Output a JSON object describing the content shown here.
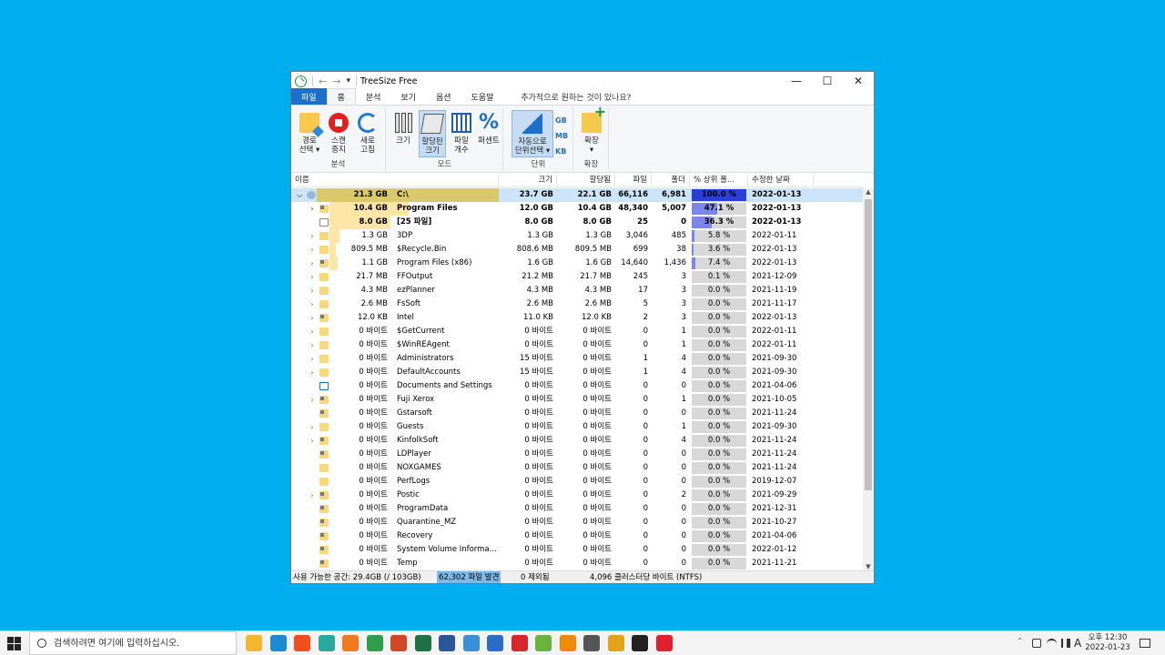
{
  "window": {
    "title": "TreeSize Free",
    "controls": {
      "minimize": "—",
      "maximize": "☐",
      "close": "✕"
    }
  },
  "quick_access": {
    "back": "←",
    "forward": "→",
    "more": "▾"
  },
  "tabs": [
    {
      "label": "파일",
      "state": "file"
    },
    {
      "label": "홈",
      "state": "active"
    },
    {
      "label": "분석",
      "state": ""
    },
    {
      "label": "보기",
      "state": ""
    },
    {
      "label": "옵션",
      "state": ""
    },
    {
      "label": "도움말",
      "state": ""
    },
    {
      "label": "추가적으로 원하는 것이 있나요?",
      "state": "tell"
    }
  ],
  "ribbon": {
    "groups": {
      "analysis": "분석",
      "mode": "모드",
      "unit": "단위",
      "expand": "확장"
    },
    "buttons": {
      "path_select": "경로\n선택 ▾",
      "stop_scan": "스캔\n중지",
      "refresh": "새로\n고침",
      "size": "크기",
      "allocated": "할당된\n크기",
      "file_count": "파일\n개수",
      "percent": "퍼센트",
      "auto_unit": "자동으로\n단위선택 ▾",
      "expand": "확장\n▾"
    },
    "unit_options": [
      "GB",
      "MB",
      "KB"
    ]
  },
  "columns": {
    "name": "이름",
    "size": "크기",
    "allocated": "할당됨",
    "files": "파일",
    "folders": "폴더",
    "pct": "% 상위 폴...",
    "modified": "수정한 날짜"
  },
  "rows": [
    {
      "exp": "⌵",
      "indent": 0,
      "icon": "drive",
      "sizeLabel": "21.3 GB",
      "name": "C:\\",
      "size": "23.7 GB",
      "alloc": "22.1 GB",
      "files": "66,116",
      "folders": "6,981",
      "pct": "100.0 %",
      "pctVal": 100,
      "barFrac": 1.0,
      "date": "2022-01-13",
      "bold": true,
      "selected": true
    },
    {
      "exp": "›",
      "indent": 1,
      "icon": "lock",
      "sizeLabel": "10.4 GB",
      "name": "Program Files",
      "size": "12.0 GB",
      "alloc": "10.4 GB",
      "files": "48,340",
      "folders": "5,007",
      "pct": "47.1 %",
      "pctVal": 47.1,
      "barFrac": 0.47,
      "date": "2022-01-13",
      "bold": true
    },
    {
      "exp": "",
      "indent": 1,
      "icon": "file",
      "sizeLabel": "8.0 GB",
      "name": "[25 파일]",
      "size": "8.0 GB",
      "alloc": "8.0 GB",
      "files": "25",
      "folders": "0",
      "pct": "36.3 %",
      "pctVal": 36.3,
      "barFrac": 0.36,
      "date": "2022-01-13",
      "bold": true
    },
    {
      "exp": "›",
      "indent": 1,
      "icon": "folder",
      "sizeLabel": "1.3 GB",
      "name": "3DP",
      "size": "1.3 GB",
      "alloc": "1.3 GB",
      "files": "3,046",
      "folders": "485",
      "pct": "5.8 %",
      "pctVal": 5.8,
      "barFrac": 0.06,
      "date": "2022-01-11"
    },
    {
      "exp": "›",
      "indent": 1,
      "icon": "folder",
      "sizeLabel": "809.5 MB",
      "name": "$Recycle.Bin",
      "size": "808.6 MB",
      "alloc": "809.5 MB",
      "files": "699",
      "folders": "38",
      "pct": "3.6 %",
      "pctVal": 3.6,
      "barFrac": 0.04,
      "date": "2022-01-13"
    },
    {
      "exp": "›",
      "indent": 1,
      "icon": "lock",
      "sizeLabel": "1.1 GB",
      "name": "Program Files (x86)",
      "size": "1.6 GB",
      "alloc": "1.6 GB",
      "files": "14,640",
      "folders": "1,436",
      "pct": "7.4 %",
      "pctVal": 7.4,
      "barFrac": 0.05,
      "date": "2022-01-13"
    },
    {
      "exp": "›",
      "indent": 1,
      "icon": "folder",
      "sizeLabel": "21.7 MB",
      "name": "FFOutput",
      "size": "21.2 MB",
      "alloc": "21.7 MB",
      "files": "245",
      "folders": "3",
      "pct": "0.1 %",
      "pctVal": 0.1,
      "barFrac": 0,
      "date": "2021-12-09"
    },
    {
      "exp": "›",
      "indent": 1,
      "icon": "folder",
      "sizeLabel": "4.3 MB",
      "name": "ezPlanner",
      "size": "4.3 MB",
      "alloc": "4.3 MB",
      "files": "17",
      "folders": "3",
      "pct": "0.0 %",
      "pctVal": 0,
      "barFrac": 0,
      "date": "2021-11-19"
    },
    {
      "exp": "›",
      "indent": 1,
      "icon": "folder",
      "sizeLabel": "2.6 MB",
      "name": "FsSoft",
      "size": "2.6 MB",
      "alloc": "2.6 MB",
      "files": "5",
      "folders": "3",
      "pct": "0.0 %",
      "pctVal": 0,
      "barFrac": 0,
      "date": "2021-11-17"
    },
    {
      "exp": "›",
      "indent": 1,
      "icon": "lock",
      "sizeLabel": "12.0 KB",
      "name": "Intel",
      "size": "11.0 KB",
      "alloc": "12.0 KB",
      "files": "2",
      "folders": "3",
      "pct": "0.0 %",
      "pctVal": 0,
      "barFrac": 0,
      "date": "2022-01-13"
    },
    {
      "exp": "›",
      "indent": 1,
      "icon": "folder",
      "sizeLabel": "0 바이트",
      "name": "$GetCurrent",
      "size": "0 바이트",
      "alloc": "0 바이트",
      "files": "0",
      "folders": "1",
      "pct": "0.0 %",
      "pctVal": 0,
      "barFrac": 0,
      "date": "2022-01-11"
    },
    {
      "exp": "›",
      "indent": 1,
      "icon": "folder",
      "sizeLabel": "0 바이트",
      "name": "$WinREAgent",
      "size": "0 바이트",
      "alloc": "0 바이트",
      "files": "0",
      "folders": "1",
      "pct": "0.0 %",
      "pctVal": 0,
      "barFrac": 0,
      "date": "2022-01-11"
    },
    {
      "exp": "›",
      "indent": 1,
      "icon": "folder",
      "sizeLabel": "0 바이트",
      "name": "Administrators",
      "size": "15 바이트",
      "alloc": "0 바이트",
      "files": "1",
      "folders": "4",
      "pct": "0.0 %",
      "pctVal": 0,
      "barFrac": 0,
      "date": "2021-09-30"
    },
    {
      "exp": "›",
      "indent": 1,
      "icon": "folder",
      "sizeLabel": "0 바이트",
      "name": "DefaultAccounts",
      "size": "15 바이트",
      "alloc": "0 바이트",
      "files": "1",
      "folders": "4",
      "pct": "0.0 %",
      "pctVal": 0,
      "barFrac": 0,
      "date": "2021-09-30"
    },
    {
      "exp": "",
      "indent": 1,
      "icon": "link",
      "sizeLabel": "0 바이트",
      "name": "Documents and Settings",
      "size": "0 바이트",
      "alloc": "0 바이트",
      "files": "0",
      "folders": "0",
      "pct": "0.0 %",
      "pctVal": 0,
      "barFrac": 0,
      "date": "2021-04-06"
    },
    {
      "exp": "›",
      "indent": 1,
      "icon": "lock",
      "sizeLabel": "0 바이트",
      "name": "Fuji Xerox",
      "size": "0 바이트",
      "alloc": "0 바이트",
      "files": "0",
      "folders": "1",
      "pct": "0.0 %",
      "pctVal": 0,
      "barFrac": 0,
      "date": "2021-10-05"
    },
    {
      "exp": "",
      "indent": 1,
      "icon": "lock",
      "sizeLabel": "0 바이트",
      "name": "Gstarsoft",
      "size": "0 바이트",
      "alloc": "0 바이트",
      "files": "0",
      "folders": "0",
      "pct": "0.0 %",
      "pctVal": 0,
      "barFrac": 0,
      "date": "2021-11-24"
    },
    {
      "exp": "›",
      "indent": 1,
      "icon": "folder",
      "sizeLabel": "0 바이트",
      "name": "Guests",
      "size": "0 바이트",
      "alloc": "0 바이트",
      "files": "0",
      "folders": "1",
      "pct": "0.0 %",
      "pctVal": 0,
      "barFrac": 0,
      "date": "2021-09-30"
    },
    {
      "exp": "›",
      "indent": 1,
      "icon": "lock",
      "sizeLabel": "0 바이트",
      "name": "KinfolkSoft",
      "size": "0 바이트",
      "alloc": "0 바이트",
      "files": "0",
      "folders": "4",
      "pct": "0.0 %",
      "pctVal": 0,
      "barFrac": 0,
      "date": "2021-11-24"
    },
    {
      "exp": "",
      "indent": 1,
      "icon": "lock",
      "sizeLabel": "0 바이트",
      "name": "LDPlayer",
      "size": "0 바이트",
      "alloc": "0 바이트",
      "files": "0",
      "folders": "0",
      "pct": "0.0 %",
      "pctVal": 0,
      "barFrac": 0,
      "date": "2021-11-24"
    },
    {
      "exp": "",
      "indent": 1,
      "icon": "folder",
      "sizeLabel": "0 바이트",
      "name": "NOXGAMES",
      "size": "0 바이트",
      "alloc": "0 바이트",
      "files": "0",
      "folders": "0",
      "pct": "0.0 %",
      "pctVal": 0,
      "barFrac": 0,
      "date": "2021-11-24"
    },
    {
      "exp": "",
      "indent": 1,
      "icon": "folder",
      "sizeLabel": "0 바이트",
      "name": "PerfLogs",
      "size": "0 바이트",
      "alloc": "0 바이트",
      "files": "0",
      "folders": "0",
      "pct": "0.0 %",
      "pctVal": 0,
      "barFrac": 0,
      "date": "2019-12-07"
    },
    {
      "exp": "›",
      "indent": 1,
      "icon": "lock",
      "sizeLabel": "0 바이트",
      "name": "Postic",
      "size": "0 바이트",
      "alloc": "0 바이트",
      "files": "0",
      "folders": "2",
      "pct": "0.0 %",
      "pctVal": 0,
      "barFrac": 0,
      "date": "2021-09-29"
    },
    {
      "exp": "",
      "indent": 1,
      "icon": "lock",
      "sizeLabel": "0 바이트",
      "name": "ProgramData",
      "size": "0 바이트",
      "alloc": "0 바이트",
      "files": "0",
      "folders": "0",
      "pct": "0.0 %",
      "pctVal": 0,
      "barFrac": 0,
      "date": "2021-12-31"
    },
    {
      "exp": "",
      "indent": 1,
      "icon": "lock",
      "sizeLabel": "0 바이트",
      "name": "Quarantine_MZ",
      "size": "0 바이트",
      "alloc": "0 바이트",
      "files": "0",
      "folders": "0",
      "pct": "0.0 %",
      "pctVal": 0,
      "barFrac": 0,
      "date": "2021-10-27"
    },
    {
      "exp": "",
      "indent": 1,
      "icon": "lock",
      "sizeLabel": "0 바이트",
      "name": "Recovery",
      "size": "0 바이트",
      "alloc": "0 바이트",
      "files": "0",
      "folders": "0",
      "pct": "0.0 %",
      "pctVal": 0,
      "barFrac": 0,
      "date": "2021-04-06"
    },
    {
      "exp": "",
      "indent": 1,
      "icon": "lock",
      "sizeLabel": "0 바이트",
      "name": "System Volume Informa...",
      "size": "0 바이트",
      "alloc": "0 바이트",
      "files": "0",
      "folders": "0",
      "pct": "0.0 %",
      "pctVal": 0,
      "barFrac": 0,
      "date": "2022-01-12"
    },
    {
      "exp": "",
      "indent": 1,
      "icon": "lock",
      "sizeLabel": "0 바이트",
      "name": "Temp",
      "size": "0 바이트",
      "alloc": "0 바이트",
      "files": "0",
      "folders": "0",
      "pct": "0.0 %",
      "pctVal": 0,
      "barFrac": 0,
      "date": "2021-11-21"
    }
  ],
  "status": {
    "free_space": "사용 가능한 공간: 29.4GB  (/ 103GB)",
    "found": "62,302 파일 발견",
    "excluded": "0 제외됨",
    "cluster": "4,096 클러스터당 바이트 (NTFS)"
  },
  "scrollbar": {
    "up": "▲",
    "down": "▼"
  },
  "taskbar": {
    "search_placeholder": "검색하려면 여기에 입력하십시오.",
    "apps": [
      {
        "name": "file-explorer-icon",
        "color": "#f2b630"
      },
      {
        "name": "edge-icon",
        "color": "#1b8bd6"
      },
      {
        "name": "brave-icon",
        "color": "#f24d1d"
      },
      {
        "name": "app-s-icon",
        "color": "#2aa8a0"
      },
      {
        "name": "firefox-icon",
        "color": "#f07a1d"
      },
      {
        "name": "chrome-icon",
        "color": "#2f9e4a"
      },
      {
        "name": "powerpoint-icon",
        "color": "#d24726"
      },
      {
        "name": "excel-icon",
        "color": "#1e7145"
      },
      {
        "name": "word-icon",
        "color": "#2b579a"
      },
      {
        "name": "remote-desktop-icon",
        "color": "#3b8fd6"
      },
      {
        "name": "app-c-icon",
        "color": "#2b6cc7"
      },
      {
        "name": "app-se-icon",
        "color": "#d6282c"
      },
      {
        "name": "app-green-icon",
        "color": "#6ab23a"
      },
      {
        "name": "vlc-icon",
        "color": "#f08a00"
      },
      {
        "name": "calculator-icon",
        "color": "#555555"
      },
      {
        "name": "chrome-alt-icon",
        "color": "#e3a21a"
      },
      {
        "name": "sticky-notes-icon",
        "color": "#222222"
      },
      {
        "name": "opera-icon",
        "color": "#e0202c"
      }
    ],
    "tray": {
      "chevron": "ˆ",
      "ime": "A",
      "date_time_top": "오후 12:30",
      "date_time_bottom": "2022-01-23"
    }
  }
}
